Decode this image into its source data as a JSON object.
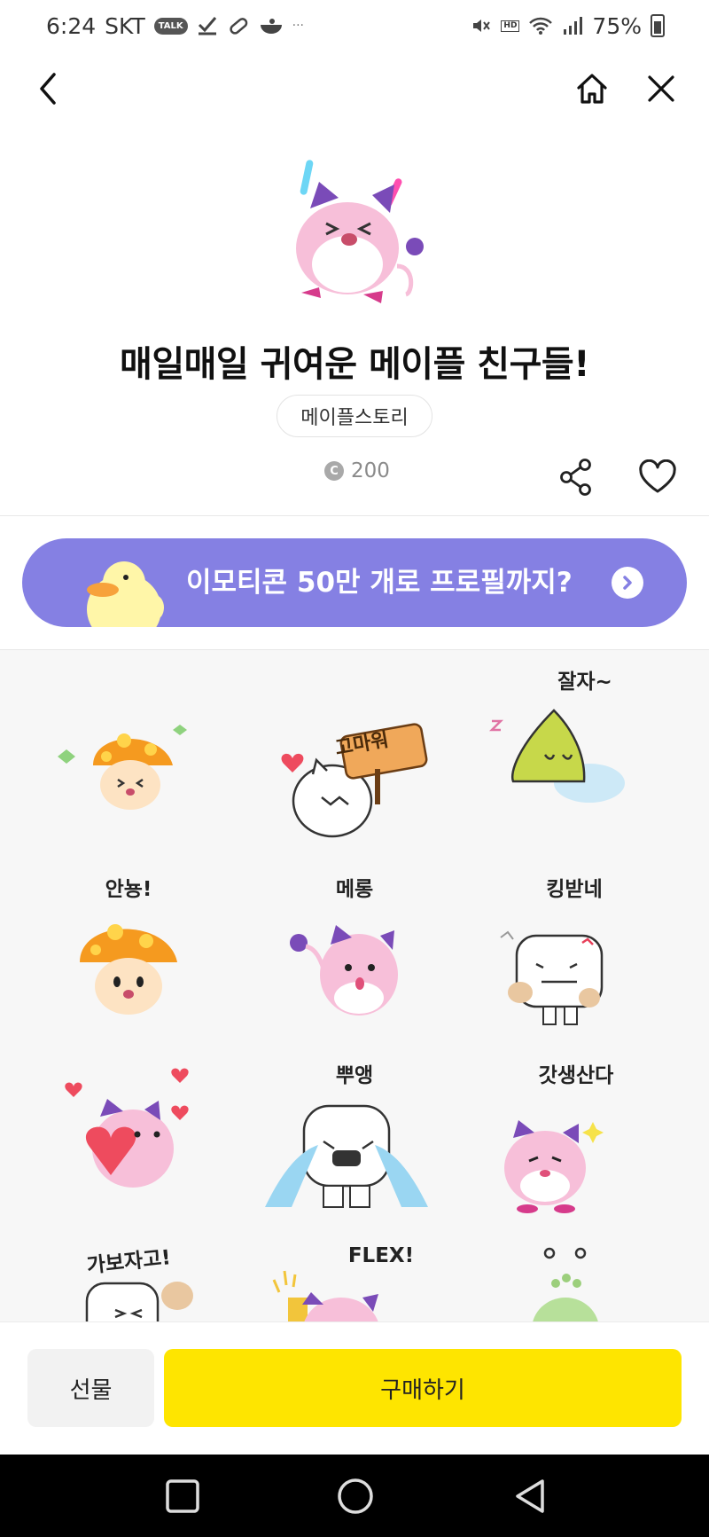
{
  "status": {
    "time": "6:24",
    "carrier": "SKT",
    "talk_badge": "TALK",
    "more": "···",
    "hd": "HD",
    "battery": "75%"
  },
  "product": {
    "title": "매일매일 귀여운 메이플 친구들!",
    "author": "메이플스토리",
    "coin_symbol": "C",
    "price": "200"
  },
  "banner": {
    "text": "이모티콘 50만 개로 프로필까지?",
    "color": "#8580e3"
  },
  "stickers": [
    {
      "label": "",
      "character": "mushroom"
    },
    {
      "label": "고마워",
      "character": "cat-sign"
    },
    {
      "label": "잘자~",
      "character": "slime"
    },
    {
      "label": "안뇽!",
      "character": "mushroom"
    },
    {
      "label": "메롱",
      "character": "pink-bean"
    },
    {
      "label": "킹받네",
      "character": "yeti"
    },
    {
      "label": "",
      "character": "pink-bean-heart"
    },
    {
      "label": "뿌앵",
      "character": "yeti-cry"
    },
    {
      "label": "갓생산다",
      "character": "pink-bean"
    },
    {
      "label": "가보자고!",
      "character": "yeti"
    },
    {
      "label": "FLEX!",
      "character": "pink-bean"
    },
    {
      "label": "",
      "character": "green-alien"
    }
  ],
  "actions": {
    "gift": "선물",
    "buy": "구매하기"
  },
  "colors": {
    "buy_button": "#fee500",
    "pink": "#f3b6d4",
    "purple": "#7a4bb8"
  }
}
